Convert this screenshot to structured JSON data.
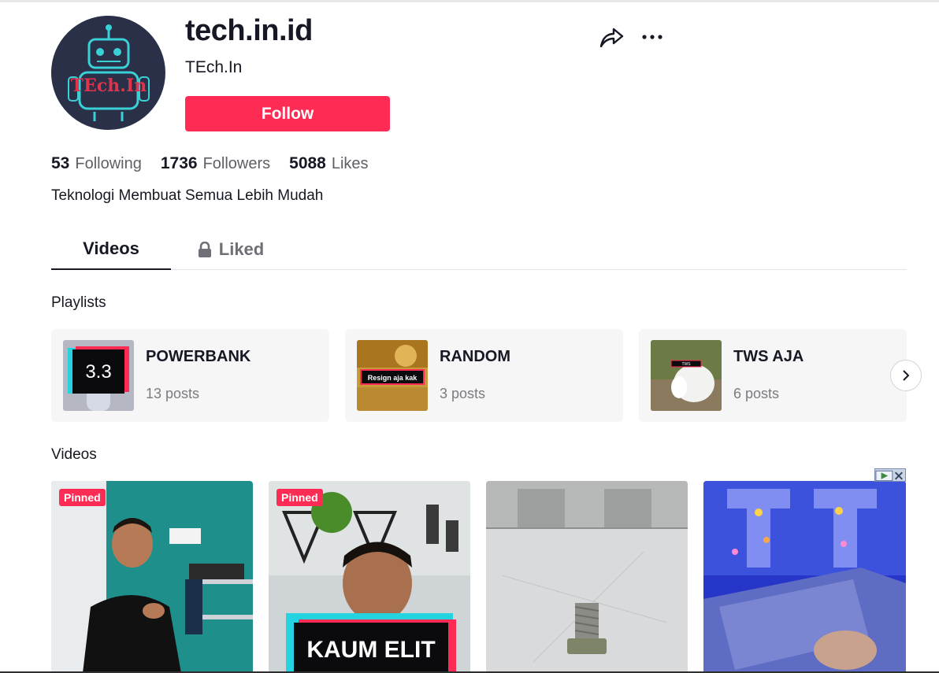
{
  "profile": {
    "username": "tech.in.id",
    "nickname": "TEch.In",
    "avatar_text": "TEch.In",
    "follow_label": "Follow",
    "bio": "Teknologi Membuat Semua Lebih Mudah",
    "stats": [
      {
        "value": "53",
        "label": "Following"
      },
      {
        "value": "1736",
        "label": "Followers"
      },
      {
        "value": "5088",
        "label": "Likes"
      }
    ]
  },
  "actions": {
    "share_icon": "share-arrow-icon",
    "more_icon": "more-dots-icon"
  },
  "tabs": [
    {
      "label": "Videos",
      "active": true
    },
    {
      "label": "Liked",
      "locked": true
    }
  ],
  "playlists_section": {
    "title": "Playlists",
    "items": [
      {
        "name": "POWERBANK",
        "count": "13 posts",
        "thumb_text": "3.3"
      },
      {
        "name": "RANDOM",
        "count": "3 posts",
        "thumb_text": "Resign aja kak"
      },
      {
        "name": "TWS AJA",
        "count": "6 posts",
        "thumb_text": "TWS"
      }
    ]
  },
  "videos_section": {
    "title": "Videos",
    "items": [
      {
        "pinned": "Pinned"
      },
      {
        "pinned": "Pinned",
        "overlay": "KAUM ELIT"
      },
      {},
      {}
    ]
  },
  "colors": {
    "accent": "#fe2c55",
    "text": "#161823",
    "muted": "#7b7b80"
  }
}
